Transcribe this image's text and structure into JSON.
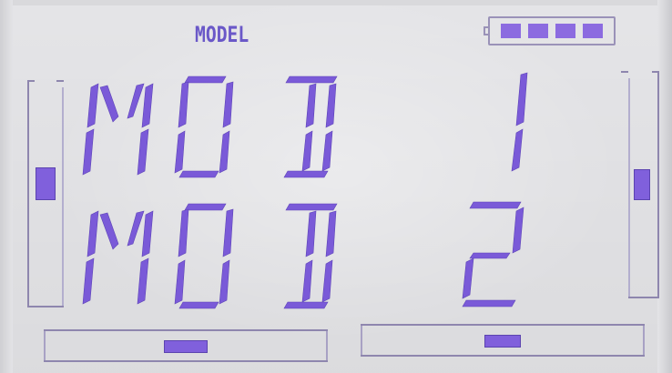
{
  "header": {
    "label": "MODEL"
  },
  "battery": {
    "cells_total": 4,
    "cells_on": 4
  },
  "display": {
    "line1": {
      "text": "MOD",
      "number": "1"
    },
    "line2": {
      "text": "MOD",
      "number": "2"
    }
  },
  "trims": {
    "left_vertical": {
      "level": 0.55
    },
    "right_vertical": {
      "level": 0.5
    },
    "left_horizontal": {
      "level": 0.5
    },
    "right_horizontal": {
      "level": 0.5
    }
  },
  "colors": {
    "lcd_background": "#e9e9ec",
    "segment": "#7a5ad8",
    "frame": "#8e86ae"
  }
}
